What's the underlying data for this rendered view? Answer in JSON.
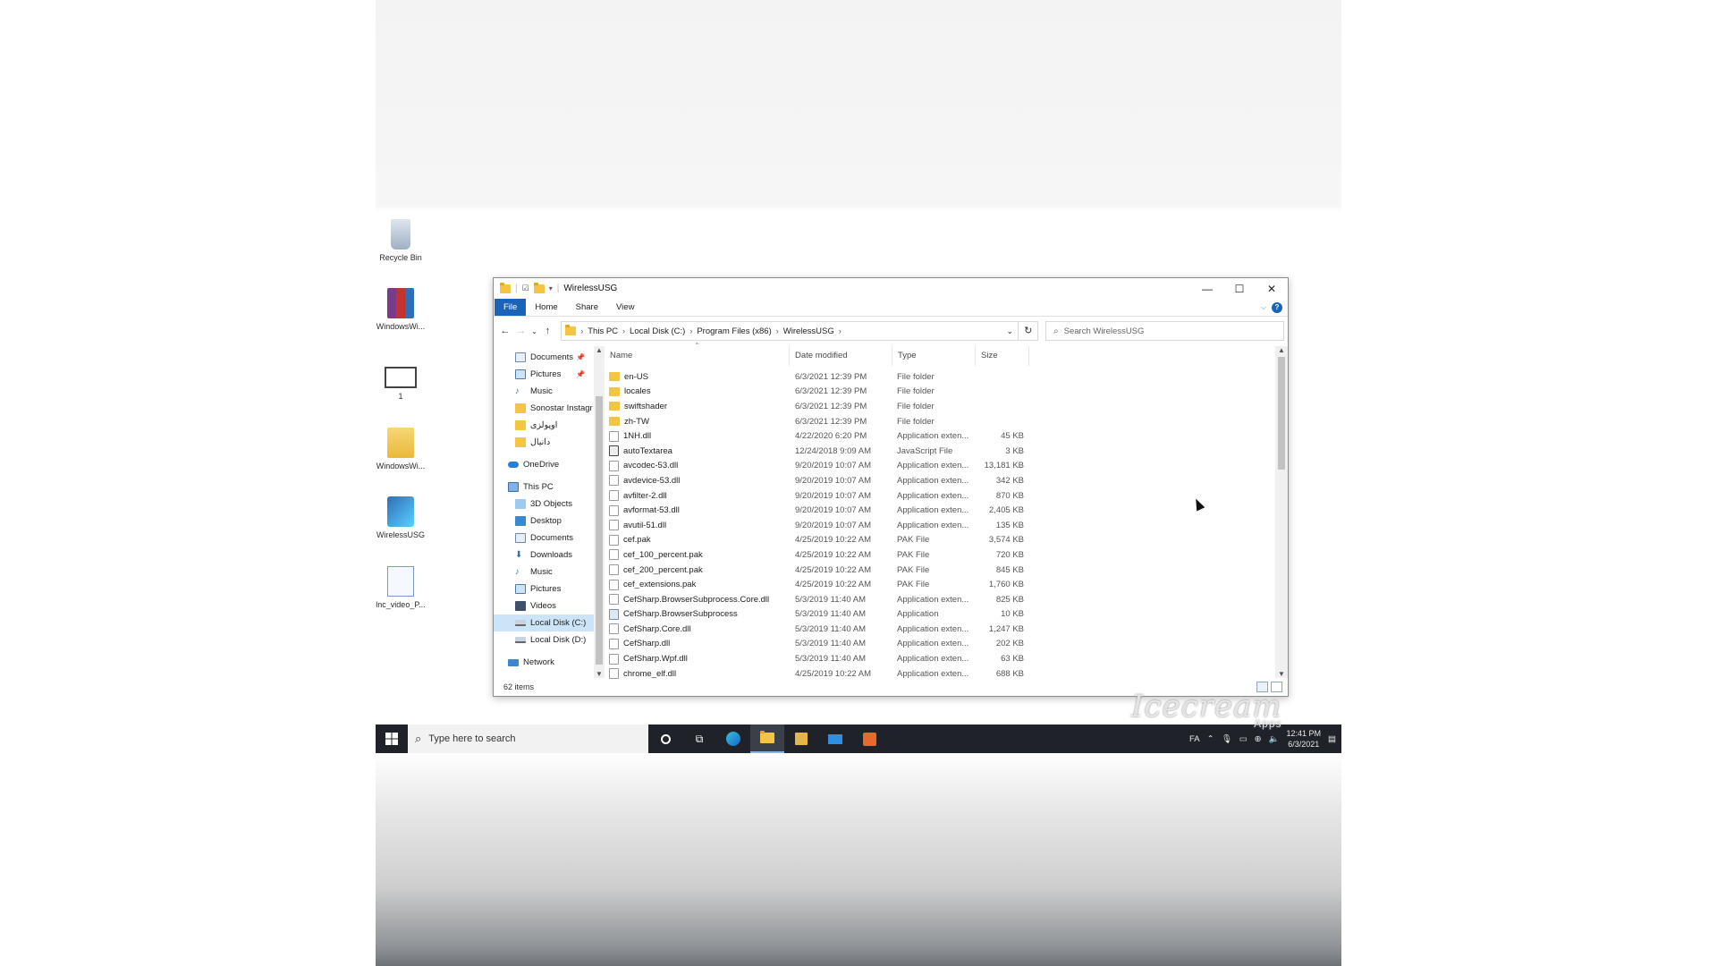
{
  "desktop": {
    "icons": [
      {
        "label": "Recycle Bin",
        "icon": "recycle-bin-icon"
      },
      {
        "label": "WindowsWi...",
        "icon": "winrar-archive-icon"
      },
      {
        "label": "1",
        "icon": "video-file-icon"
      },
      {
        "label": "WindowsWi...",
        "icon": "zip-folder-icon"
      },
      {
        "label": "WirelessUSG",
        "icon": "wirelessusg-app-icon"
      },
      {
        "label": "lnc_video_P...",
        "icon": "media-file-icon"
      }
    ]
  },
  "window": {
    "title": "WirelessUSG",
    "controls": {
      "minimize": "—",
      "maximize": "☐",
      "close": "✕"
    },
    "ribbon_tabs": [
      "File",
      "Home",
      "Share",
      "View"
    ],
    "breadcrumb": [
      "This PC",
      "Local Disk (C:)",
      "Program Files (x86)",
      "WirelessUSG"
    ],
    "search_placeholder": "Search WirelessUSG",
    "nav": [
      {
        "label": "Documents",
        "icon": "documents-icon",
        "pinned": true
      },
      {
        "label": "Pictures",
        "icon": "pictures-icon",
        "pinned": true
      },
      {
        "label": "Music",
        "icon": "music-icon"
      },
      {
        "label": "Sonostar Instagr",
        "icon": "folder-icon"
      },
      {
        "label": "اوپولزی",
        "icon": "folder-icon"
      },
      {
        "label": "دانیال",
        "icon": "folder-icon"
      },
      {
        "label": "OneDrive",
        "icon": "onedrive-icon"
      },
      {
        "label": "This PC",
        "icon": "this-pc-icon"
      },
      {
        "label": "3D Objects",
        "icon": "3d-objects-icon"
      },
      {
        "label": "Desktop",
        "icon": "desktop-icon"
      },
      {
        "label": "Documents",
        "icon": "documents-icon"
      },
      {
        "label": "Downloads",
        "icon": "downloads-icon"
      },
      {
        "label": "Music",
        "icon": "music-icon"
      },
      {
        "label": "Pictures",
        "icon": "pictures-icon"
      },
      {
        "label": "Videos",
        "icon": "videos-icon"
      },
      {
        "label": "Local Disk (C:)",
        "icon": "drive-icon",
        "selected": true
      },
      {
        "label": "Local Disk (D:)",
        "icon": "drive-icon"
      },
      {
        "label": "Network",
        "icon": "network-icon"
      }
    ],
    "columns": [
      "Name",
      "Date modified",
      "Type",
      "Size"
    ],
    "files": [
      {
        "name": "en-US",
        "date": "6/3/2021 12:39 PM",
        "type": "File folder",
        "size": "",
        "kind": "folder"
      },
      {
        "name": "locales",
        "date": "6/3/2021 12:39 PM",
        "type": "File folder",
        "size": "",
        "kind": "folder"
      },
      {
        "name": "swiftshader",
        "date": "6/3/2021 12:39 PM",
        "type": "File folder",
        "size": "",
        "kind": "folder"
      },
      {
        "name": "zh-TW",
        "date": "6/3/2021 12:39 PM",
        "type": "File folder",
        "size": "",
        "kind": "folder"
      },
      {
        "name": "1NH.dll",
        "date": "4/22/2020 6:20 PM",
        "type": "Application exten...",
        "size": "45 KB",
        "kind": "dll"
      },
      {
        "name": "autoTextarea",
        "date": "12/24/2018 9:09 AM",
        "type": "JavaScript File",
        "size": "3 KB",
        "kind": "js"
      },
      {
        "name": "avcodec-53.dll",
        "date": "9/20/2019 10:07 AM",
        "type": "Application exten...",
        "size": "13,181 KB",
        "kind": "dll"
      },
      {
        "name": "avdevice-53.dll",
        "date": "9/20/2019 10:07 AM",
        "type": "Application exten...",
        "size": "342 KB",
        "kind": "dll"
      },
      {
        "name": "avfilter-2.dll",
        "date": "9/20/2019 10:07 AM",
        "type": "Application exten...",
        "size": "870 KB",
        "kind": "dll"
      },
      {
        "name": "avformat-53.dll",
        "date": "9/20/2019 10:07 AM",
        "type": "Application exten...",
        "size": "2,405 KB",
        "kind": "dll"
      },
      {
        "name": "avutil-51.dll",
        "date": "9/20/2019 10:07 AM",
        "type": "Application exten...",
        "size": "135 KB",
        "kind": "dll"
      },
      {
        "name": "cef.pak",
        "date": "4/25/2019 10:22 AM",
        "type": "PAK File",
        "size": "3,574 KB",
        "kind": "file"
      },
      {
        "name": "cef_100_percent.pak",
        "date": "4/25/2019 10:22 AM",
        "type": "PAK File",
        "size": "720 KB",
        "kind": "file"
      },
      {
        "name": "cef_200_percent.pak",
        "date": "4/25/2019 10:22 AM",
        "type": "PAK File",
        "size": "845 KB",
        "kind": "file"
      },
      {
        "name": "cef_extensions.pak",
        "date": "4/25/2019 10:22 AM",
        "type": "PAK File",
        "size": "1,760 KB",
        "kind": "file"
      },
      {
        "name": "CefSharp.BrowserSubprocess.Core.dll",
        "date": "5/3/2019 11:40 AM",
        "type": "Application exten...",
        "size": "825 KB",
        "kind": "dll"
      },
      {
        "name": "CefSharp.BrowserSubprocess",
        "date": "5/3/2019 11:40 AM",
        "type": "Application",
        "size": "10 KB",
        "kind": "app"
      },
      {
        "name": "CefSharp.Core.dll",
        "date": "5/3/2019 11:40 AM",
        "type": "Application exten...",
        "size": "1,247 KB",
        "kind": "dll"
      },
      {
        "name": "CefSharp.dll",
        "date": "5/3/2019 11:40 AM",
        "type": "Application exten...",
        "size": "202 KB",
        "kind": "dll"
      },
      {
        "name": "CefSharp.Wpf.dll",
        "date": "5/3/2019 11:40 AM",
        "type": "Application exten...",
        "size": "63 KB",
        "kind": "dll"
      },
      {
        "name": "chrome_elf.dll",
        "date": "4/25/2019 10:22 AM",
        "type": "Application exten...",
        "size": "688 KB",
        "kind": "dll"
      }
    ],
    "status": "62 items"
  },
  "taskbar": {
    "search_placeholder": "Type here to search",
    "apps": [
      "cortana-icon",
      "task-view-icon",
      "edge-icon",
      "file-explorer-icon",
      "store-icon",
      "mail-icon",
      "app-icon"
    ],
    "language": "FA",
    "time": "12:41 PM",
    "date": "6/3/2021"
  },
  "watermark": {
    "text": "Icecream",
    "sub": "Apps"
  },
  "colors": {
    "accent": "#1a63b8",
    "taskbar": "#1f2329",
    "folder": "#f4c542",
    "selection": "#cce4f7"
  }
}
